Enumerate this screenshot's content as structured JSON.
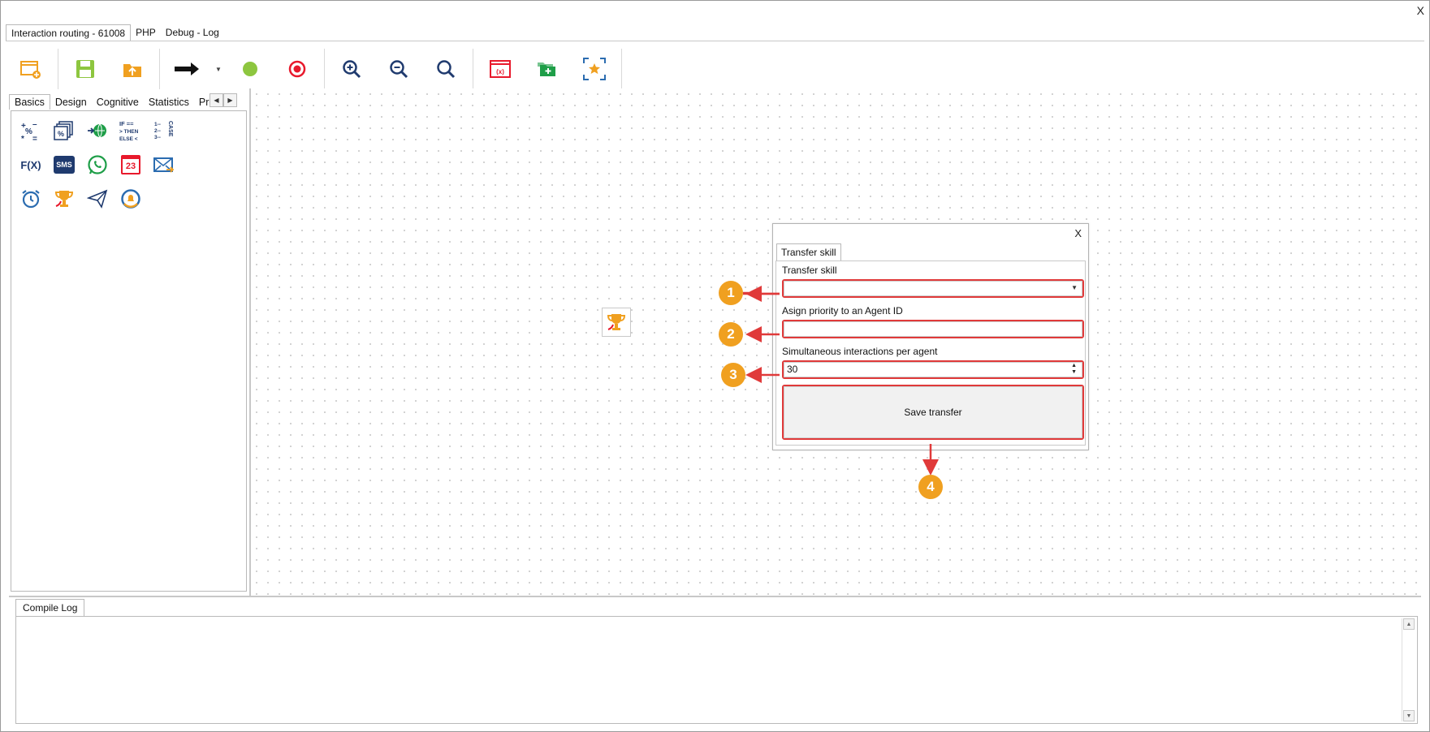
{
  "window": {
    "close_label": "X"
  },
  "top_tabs": [
    {
      "label": "Interaction routing - 61008",
      "active": true
    },
    {
      "label": "PHP",
      "active": false
    },
    {
      "label": "Debug - Log",
      "active": false
    }
  ],
  "toolbar": {
    "buttons": [
      "new-flow-icon",
      "save-icon",
      "upload-icon",
      "connector-arrow-icon",
      "start-node-icon",
      "end-node-icon",
      "zoom-in-icon",
      "zoom-out-icon",
      "zoom-reset-icon",
      "variables-icon",
      "add-folder-icon",
      "fit-view-icon"
    ]
  },
  "palette": {
    "tabs": [
      {
        "label": "Basics",
        "active": true
      },
      {
        "label": "Design",
        "active": false
      },
      {
        "label": "Cognitive",
        "active": false
      },
      {
        "label": "Statistics",
        "active": false
      },
      {
        "label": "Pre",
        "active": false
      }
    ],
    "icons": {
      "fx_label": "F(X)",
      "sms_label": "SMS",
      "calendar_label": "23",
      "case_label": "CASE",
      "if_label": "IF ==",
      "then_label": "> THEN",
      "else_label": "ELSE <"
    }
  },
  "dialog": {
    "close_label": "X",
    "tab_label": "Transfer skill",
    "fields": {
      "transfer_skill_label": "Transfer skill",
      "transfer_skill_value": "",
      "agent_id_label": "Asign priority to an Agent ID",
      "agent_id_value": "",
      "simultaneous_label": "Simultaneous interactions per agent",
      "simultaneous_value": "30"
    },
    "save_label": "Save transfer"
  },
  "callouts": [
    "1",
    "2",
    "3",
    "4"
  ],
  "log": {
    "tab_label": "Compile Log"
  },
  "colors": {
    "accent_orange": "#f0a020",
    "highlight_red": "#e03a3a",
    "green": "#8dc63f",
    "red": "#e8192c",
    "navy": "#1f3a6e"
  }
}
